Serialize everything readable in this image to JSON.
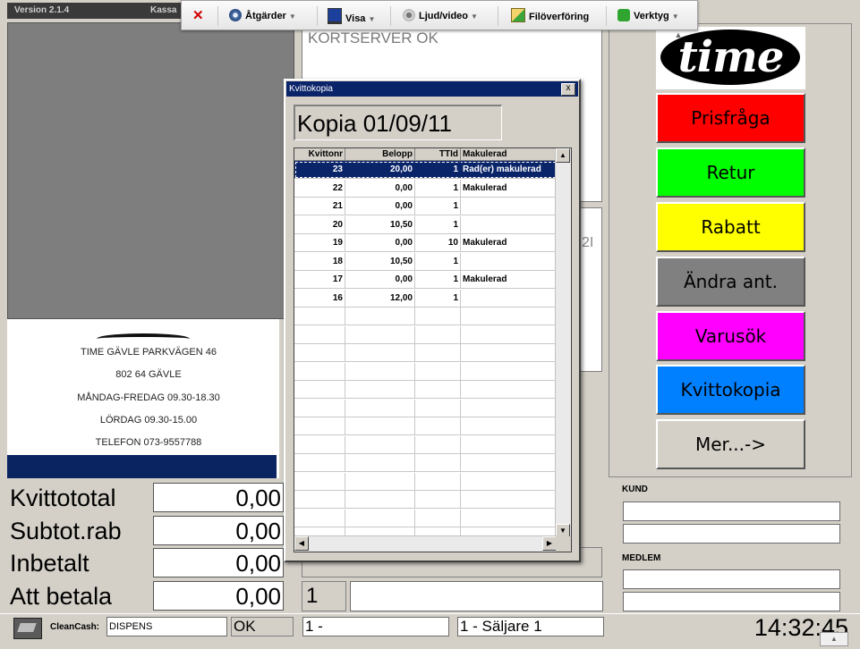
{
  "header": {
    "version": "Version 2.1.4",
    "app": "Kassa"
  },
  "toolbar": {
    "items": [
      {
        "label": "Åtgärder",
        "icon": "gear-icon"
      },
      {
        "label": "Visa",
        "icon": "monitor-icon"
      },
      {
        "label": "Ljud/video",
        "icon": "speaker-icon"
      },
      {
        "label": "Filöverföring",
        "icon": "file-transfer-icon"
      },
      {
        "label": "Verktyg",
        "icon": "puzzle-icon"
      }
    ],
    "close_icon": "close-icon"
  },
  "server_status": "KORTSERVER OK",
  "partial_text": "2I",
  "receipt": {
    "lines": [
      "TIME GÄVLE PARKVÄGEN 46",
      "802 64 GÄVLE",
      "MÅNDAG-FREDAG 09.30-18.30",
      "LÖRDAG  09.30-15.00",
      "TELEFON 073-9557788"
    ]
  },
  "totals": [
    {
      "label": "Kvittototal",
      "value": "0,00"
    },
    {
      "label": "Subtot.rab",
      "value": "0,00"
    },
    {
      "label": "Inbetalt",
      "value": "0,00"
    },
    {
      "label": "Att betala",
      "value": "0,00"
    }
  ],
  "quantity": "1",
  "dialog": {
    "title": "Kvittokopia",
    "close": "x",
    "heading": "Kopia 01/09/11",
    "columns": [
      "Kvittonr",
      "Belopp",
      "TTId",
      "Makulerad"
    ],
    "rows": [
      [
        "23",
        "20,00",
        "1",
        "Rad(er) makulerad"
      ],
      [
        "22",
        "0,00",
        "1",
        "Makulerad"
      ],
      [
        "21",
        "0,00",
        "1",
        ""
      ],
      [
        "20",
        "10,50",
        "1",
        ""
      ],
      [
        "19",
        "0,00",
        "10",
        "Makulerad"
      ],
      [
        "18",
        "10,50",
        "1",
        ""
      ],
      [
        "17",
        "0,00",
        "1",
        "Makulerad"
      ],
      [
        "16",
        "12,00",
        "1",
        ""
      ]
    ]
  },
  "logo": "time",
  "buttons": [
    {
      "label": "Prisfråga",
      "color": "#ff0000"
    },
    {
      "label": "Retur",
      "color": "#00ff00"
    },
    {
      "label": "Rabatt",
      "color": "#ffff00"
    },
    {
      "label": "Ändra ant.",
      "color": "#808080"
    },
    {
      "label": "Varusök",
      "color": "#ff00ff"
    },
    {
      "label": "Kvittokopia",
      "color": "#0080ff"
    },
    {
      "label": "Mer...->",
      "color": "#d4d0c8"
    }
  ],
  "kund_label": "KUND",
  "medlem_label": "MEDLEM",
  "status": {
    "cleancash_label": "CleanCash:",
    "cleancash_value": "DISPENS",
    "ok": "OK",
    "register": "1 -",
    "seller": "1 - Säljare 1",
    "time": "14:32:45"
  }
}
